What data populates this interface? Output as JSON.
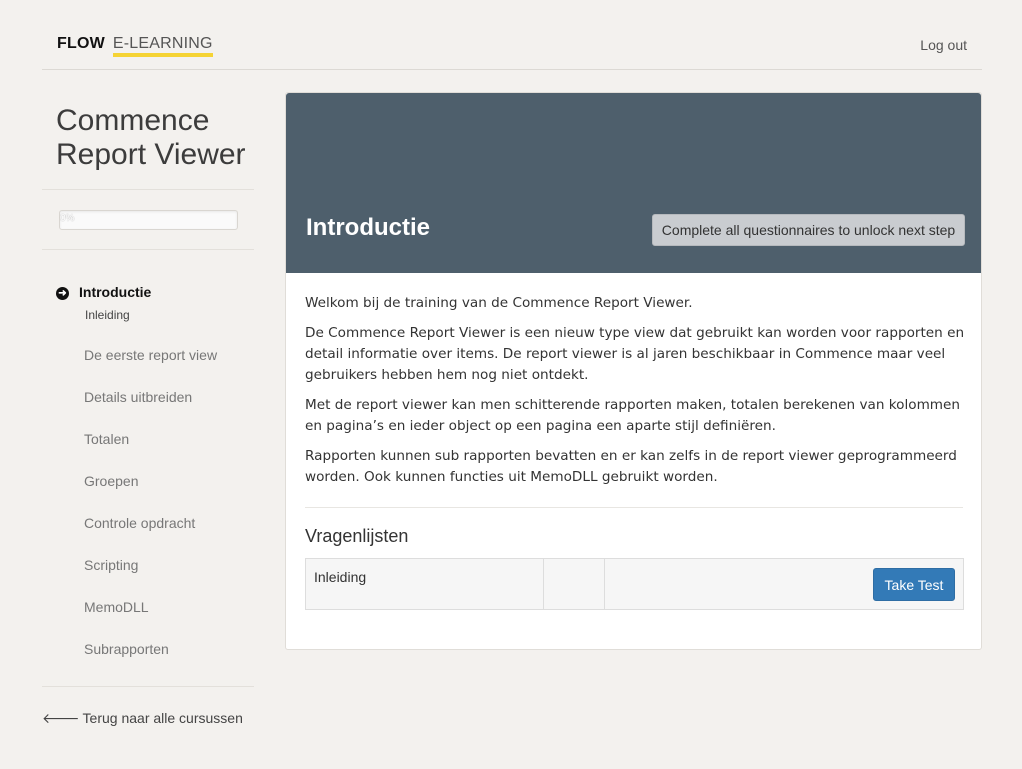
{
  "header": {
    "brand_primary": "FLOW",
    "brand_secondary": "E-LEARNING",
    "logout_label": "Log out"
  },
  "sidebar": {
    "course_title": "Commence Report Viewer",
    "progress_label": "0%",
    "progress_value": 0,
    "active_item": {
      "label": "Introductie",
      "sub_label": "Inleiding"
    },
    "items": [
      {
        "label": "De eerste report view"
      },
      {
        "label": "Details uitbreiden"
      },
      {
        "label": "Totalen"
      },
      {
        "label": "Groepen"
      },
      {
        "label": "Controle opdracht"
      },
      {
        "label": "Scripting"
      },
      {
        "label": "MemoDLL"
      },
      {
        "label": "Subrapporten"
      }
    ],
    "back_label": "Terug naar alle cursussen"
  },
  "main": {
    "title": "Introductie",
    "unlock_button_label": "Complete all questionnaires to unlock next step",
    "paragraphs": [
      "Welkom bij de training van de Commence Report Viewer.",
      "De Commence Report Viewer is een nieuw type view dat gebruikt kan worden voor rapporten en detail informatie over items. De report viewer is al jaren beschikbaar in Commence maar veel gebruikers hebben hem nog niet ontdekt.",
      "Met de report viewer kan men schitterende rapporten maken, totalen berekenen van kolommen en pagina’s en ieder object op een pagina een aparte stijl definiëren.",
      "Rapporten kunnen sub rapporten bevatten en er kan zelfs in de report viewer geprogrammeerd worden. Ook kunnen functies uit MemoDLL gebruikt worden."
    ],
    "questionnaires": {
      "heading": "Vragenlijsten",
      "rows": [
        {
          "name": "Inleiding",
          "score": "",
          "action_label": "Take Test"
        }
      ]
    }
  },
  "colors": {
    "hero_background": "#4e5f6c",
    "brand_underline": "#f5d334",
    "primary_button": "#337ab7",
    "page_background": "#f3f1ee"
  },
  "icons": {
    "active_nav": "circle-arrow-right-icon",
    "back": "arrow-left-icon"
  }
}
